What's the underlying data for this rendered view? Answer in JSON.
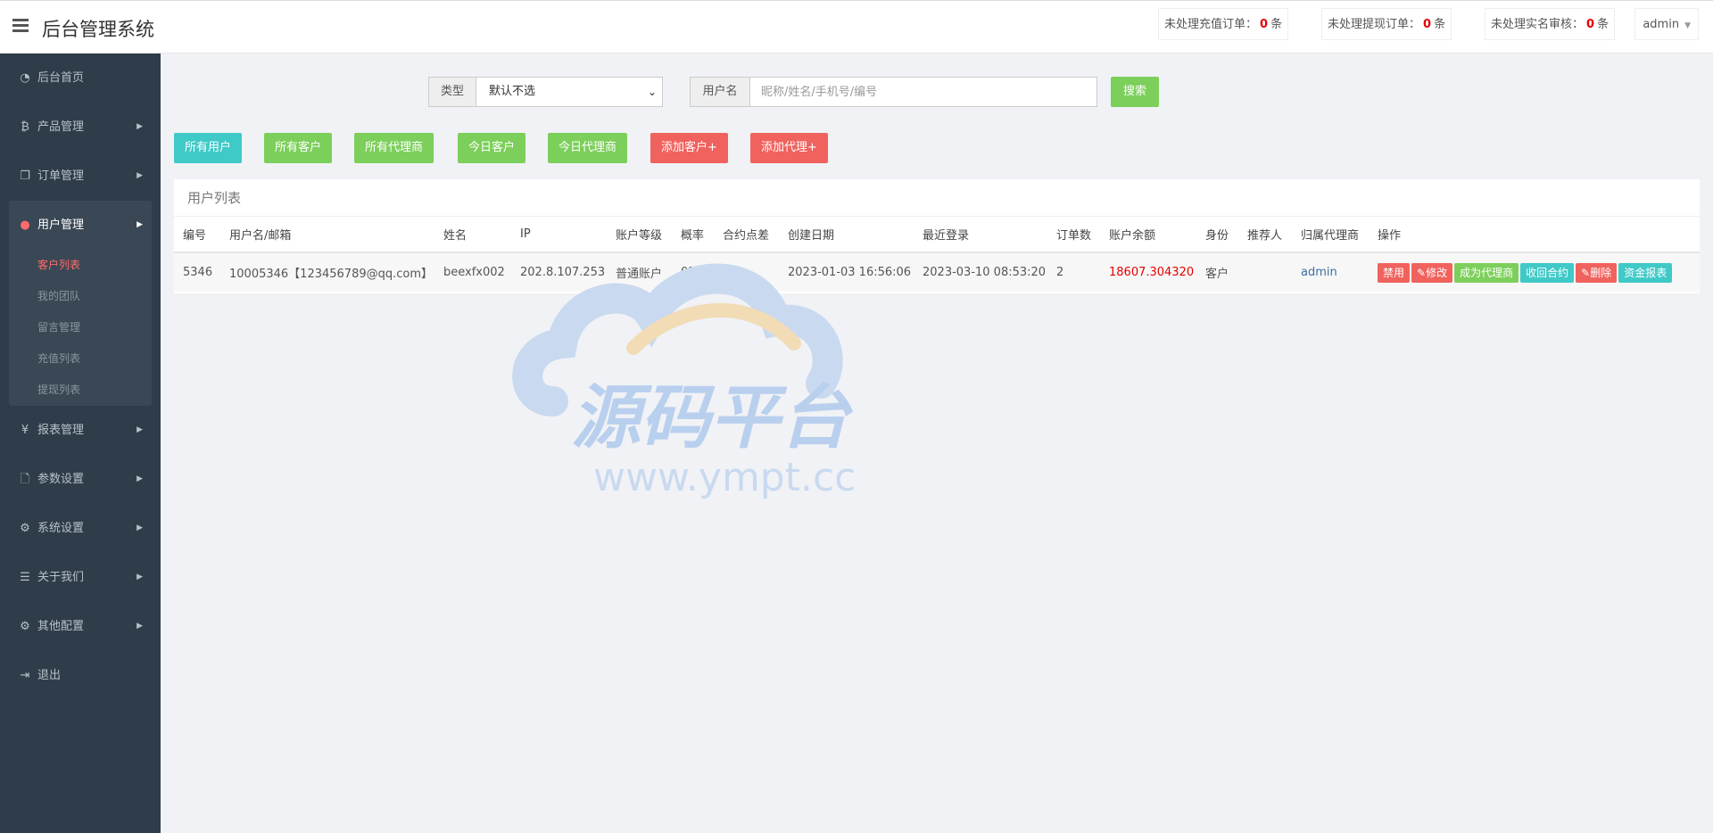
{
  "header": {
    "title": "后台管理系统",
    "badges": [
      {
        "label": "未处理充值订单：",
        "count": "0",
        "unit": "条"
      },
      {
        "label": "未处理提现订单：",
        "count": "0",
        "unit": "条"
      },
      {
        "label": "未处理实名审核：",
        "count": "0",
        "unit": "条"
      }
    ],
    "user": "admin"
  },
  "sidebar": {
    "items": [
      {
        "label": "后台首页",
        "icon": "dashboard-icon"
      },
      {
        "label": "产品管理",
        "icon": "bitcoin-icon"
      },
      {
        "label": "订单管理",
        "icon": "copy-icon"
      },
      {
        "label": "用户管理",
        "icon": "user-icon"
      },
      {
        "label": "报表管理",
        "icon": "yen-icon"
      },
      {
        "label": "参数设置",
        "icon": "file-icon"
      },
      {
        "label": "系统设置",
        "icon": "gears-icon"
      },
      {
        "label": "关于我们",
        "icon": "list-icon"
      },
      {
        "label": "其他配置",
        "icon": "gear-icon"
      },
      {
        "label": "退出",
        "icon": "sign-out-icon"
      }
    ],
    "sub_items": [
      "客户列表",
      "我的团队",
      "留言管理",
      "充值列表",
      "提现列表"
    ]
  },
  "filters": {
    "type_label": "类型",
    "type_value": "默认不选",
    "username_label": "用户名",
    "username_placeholder": "昵称/姓名/手机号/编号",
    "search_label": "搜索"
  },
  "actions": [
    "所有用户",
    "所有客户",
    "所有代理商",
    "今日客户",
    "今日代理商",
    "添加客户+",
    "添加代理+"
  ],
  "table": {
    "title": "用户列表",
    "columns": [
      "编号",
      "用户名/邮箱",
      "姓名",
      "IP",
      "账户等级",
      "概率",
      "合约点差",
      "创建日期",
      "最近登录",
      "订单数",
      "账户余额",
      "身份",
      "推荐人",
      "归属代理商",
      "操作"
    ],
    "rows": [
      {
        "id": "5346",
        "username": "10005346【123456789@qq.com】",
        "name": "beexfx002",
        "ip": "202.8.107.253",
        "level": "普通账户",
        "rate": "0%",
        "spread": "0,0",
        "created": "2023-01-03 16:56:06",
        "last_login": "2023-03-10 08:53:20",
        "orders": "2",
        "balance": "18607.304320",
        "identity": "客户",
        "referrer": "",
        "agent": "admin"
      }
    ],
    "ops": [
      "禁用",
      "修改",
      "成为代理商",
      "收回合约",
      "删除",
      "资金报表"
    ]
  },
  "watermark": {
    "text": "源码平台",
    "url": "www.ympt.cc"
  }
}
